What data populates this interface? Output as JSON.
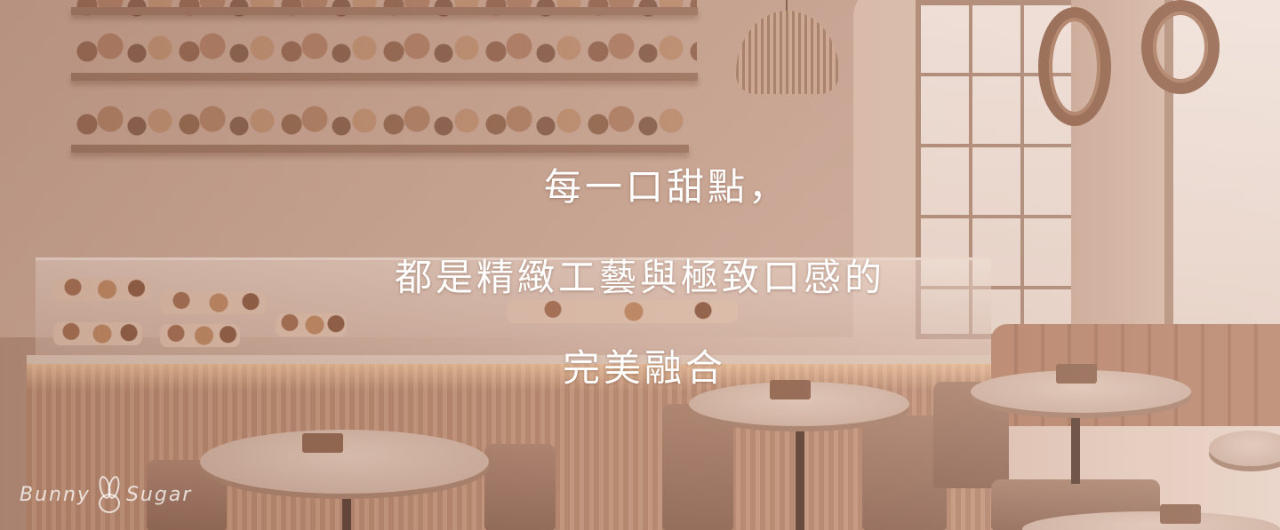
{
  "hero": {
    "tagline": [
      "每一口甜點，",
      "都是精緻工藝與極致口感的",
      "完美融合"
    ],
    "logo": {
      "left": "Bunny",
      "right": "Sugar",
      "icon": "bunny-icon"
    }
  },
  "colors": {
    "text": "#ffffff",
    "logo": "#ffffffbf",
    "wood": "#a9826e",
    "wall": "#c29d8b"
  }
}
